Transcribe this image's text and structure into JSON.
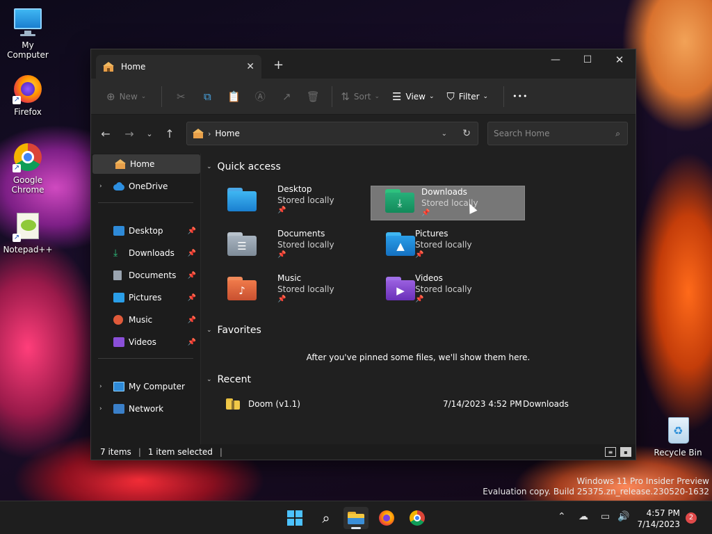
{
  "desktop": {
    "icons": [
      {
        "label": "My Computer"
      },
      {
        "label": "Firefox"
      },
      {
        "label": "Google Chrome"
      },
      {
        "label": "Notepad++"
      },
      {
        "label": "Recycle Bin"
      }
    ]
  },
  "window": {
    "tab_title": "Home",
    "tab_close": "✕",
    "new_tab": "+",
    "controls": {
      "minimize": "—",
      "maximize": "☐",
      "close": "✕"
    }
  },
  "toolbar": {
    "new_label": "New",
    "sort_label": "Sort",
    "view_label": "View",
    "filter_label": "Filter",
    "more_label": "•••"
  },
  "address": {
    "crumb": "Home",
    "search_placeholder": "Search Home"
  },
  "sidebar": {
    "items": [
      {
        "label": "Home"
      },
      {
        "label": "OneDrive"
      },
      {
        "label": "Desktop"
      },
      {
        "label": "Downloads"
      },
      {
        "label": "Documents"
      },
      {
        "label": "Pictures"
      },
      {
        "label": "Music"
      },
      {
        "label": "Videos"
      },
      {
        "label": "My Computer"
      },
      {
        "label": "Network"
      }
    ]
  },
  "content": {
    "quick_access_title": "Quick access",
    "quick_access": [
      {
        "name": "Desktop",
        "sub": "Stored locally"
      },
      {
        "name": "Downloads",
        "sub": "Stored locally"
      },
      {
        "name": "Documents",
        "sub": "Stored locally"
      },
      {
        "name": "Pictures",
        "sub": "Stored locally"
      },
      {
        "name": "Music",
        "sub": "Stored locally"
      },
      {
        "name": "Videos",
        "sub": "Stored locally"
      }
    ],
    "favorites_title": "Favorites",
    "favorites_message": "After you've pinned some files, we'll show them here.",
    "recent_title": "Recent",
    "recent": [
      {
        "name": "Doom (v1.1)",
        "date": "7/14/2023 4:52 PM",
        "location": "Downloads"
      }
    ]
  },
  "status": {
    "items": "7 items",
    "selected": "1 item selected"
  },
  "watermark": {
    "line1": "Windows 11 Pro Insider Preview",
    "line2": "Evaluation copy. Build 25375.zn_release.230520-1632"
  },
  "taskbar": {
    "time": "4:57 PM",
    "date": "7/14/2023",
    "notifications": "2"
  },
  "colors": {
    "accent": "#60cdff",
    "folder_blue": "#2e8ad8",
    "folder_teal": "#16a085",
    "selection": "#777777"
  }
}
